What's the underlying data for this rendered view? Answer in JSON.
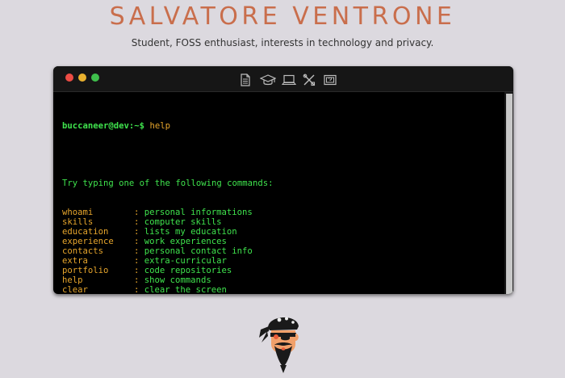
{
  "header": {
    "title": "SALVATORE VENTRONE",
    "subtitle": "Student, FOSS enthusiast, interests in technology and privacy."
  },
  "terminal": {
    "toolbar_icons": [
      "document-icon",
      "graduation-cap-icon",
      "laptop-icon",
      "tools-icon",
      "picture-icon"
    ],
    "prompt": "buccaneer@dev:~$",
    "command": "help",
    "intro": "Try typing one of the following commands:",
    "commands": [
      {
        "name": "whoami",
        "desc": "personal informations"
      },
      {
        "name": "skills",
        "desc": "computer skills"
      },
      {
        "name": "education",
        "desc": "lists my education"
      },
      {
        "name": "experience",
        "desc": "work experiences"
      },
      {
        "name": "contacts",
        "desc": "personal contact info"
      },
      {
        "name": "extra",
        "desc": "extra-curricular"
      },
      {
        "name": "portfolio",
        "desc": "code repositories"
      },
      {
        "name": "help",
        "desc": "show commands"
      },
      {
        "name": "clear",
        "desc": "clear the screen"
      }
    ],
    "separator": ":",
    "colors": {
      "prompt": "#3fe34d",
      "command": "#e6a52c",
      "background": "#000000"
    }
  },
  "avatar": {
    "icon": "pirate-avatar-icon"
  }
}
